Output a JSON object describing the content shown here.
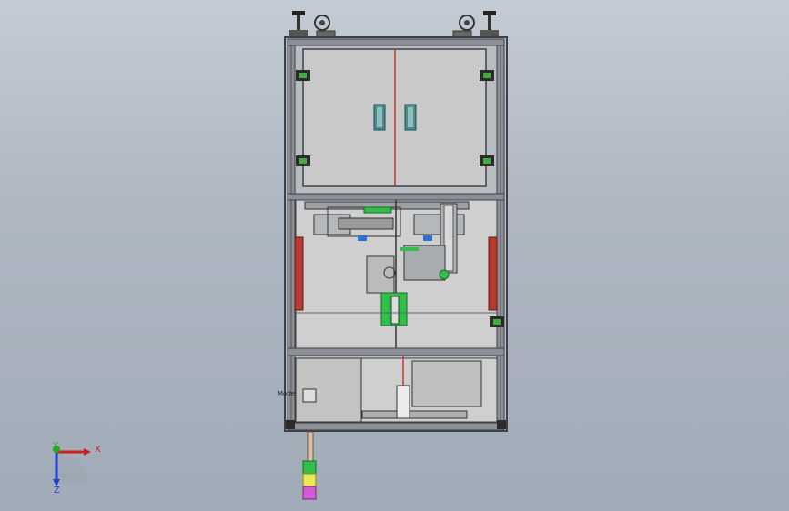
{
  "viewport": {
    "background_top": "#c3cbd4",
    "background_bottom": "#a1abb7"
  },
  "model": {
    "colors": {
      "frame": "#8c9096",
      "frame_dark": "#3e4248",
      "panel": "#c9c9c9",
      "panel_light": "#d4d4d4",
      "accent_red": "#c0392b",
      "accent_green": "#2ecc40",
      "accent_blue": "#2a6fd6",
      "handle": "#4a8c8c",
      "stack_light_green": "#2fbf4a",
      "stack_light_yellow": "#e8e85a",
      "stack_light_magenta": "#d45ad4"
    },
    "panel_tag": "Mode"
  },
  "triad": {
    "x_label": "X",
    "y_label": "Y",
    "z_label": "Z",
    "x_color": "#cc2020",
    "y_color": "#22aa22",
    "z_color": "#2040cc"
  }
}
